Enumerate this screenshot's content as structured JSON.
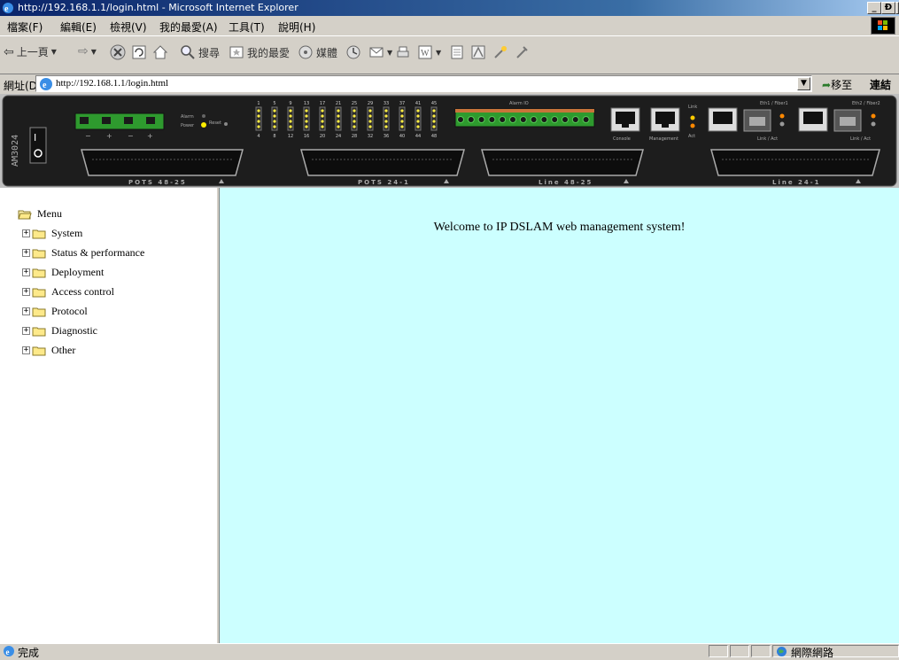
{
  "window": {
    "title": "http://192.168.1.1/login.html - Microsoft Internet Explorer",
    "controls": {
      "minimize": "_",
      "restore": "Ɖ",
      "close": "×"
    }
  },
  "menubar": {
    "items": [
      "檔案(F)",
      "編輯(E)",
      "檢視(V)",
      "我的最愛(A)",
      "工具(T)",
      "說明(H)"
    ]
  },
  "toolbar": {
    "back": "上一頁",
    "search": "搜尋",
    "favorites": "我的最愛",
    "media": "媒體"
  },
  "addressbar": {
    "label": "網址(D)",
    "url": "http://192.168.1.1/login.html",
    "go": "移至",
    "links": "連結"
  },
  "device_panel": {
    "model": "AM3024",
    "port_labels": [
      "POTS 48-25",
      "POTS 24-1",
      "Line 48-25",
      "Line 24-1"
    ],
    "led_labels": {
      "alarm": "Alarm",
      "power": "Power",
      "reset": "Reset",
      "alarm_io": "Alarm IO",
      "link": "Link",
      "act": "Act",
      "console": "Console",
      "management": "Management",
      "eth1": "Eth1 / Fiber1",
      "eth2": "Eth2 / Fiber2",
      "link_act": "Link / Act"
    },
    "top_numbers": [
      "1",
      "5",
      "9",
      "13",
      "17",
      "21",
      "25",
      "29",
      "33",
      "37",
      "41",
      "45"
    ],
    "bottom_numbers": [
      "4",
      "8",
      "12",
      "16",
      "20",
      "24",
      "28",
      "32",
      "36",
      "40",
      "44",
      "48"
    ]
  },
  "tree": {
    "root": "Menu",
    "items": [
      "System",
      "Status & performance",
      "Deployment",
      "Access control",
      "Protocol",
      "Diagnostic",
      "Other"
    ]
  },
  "main": {
    "welcome": "Welcome to IP DSLAM web management system!"
  },
  "statusbar": {
    "text": "完成",
    "zone": "網際網路"
  },
  "colors": {
    "titlebar": "#0a246a",
    "chrome": "#d4d0c8",
    "main_bg": "#ccffff",
    "panel": "#1a1a1a"
  }
}
